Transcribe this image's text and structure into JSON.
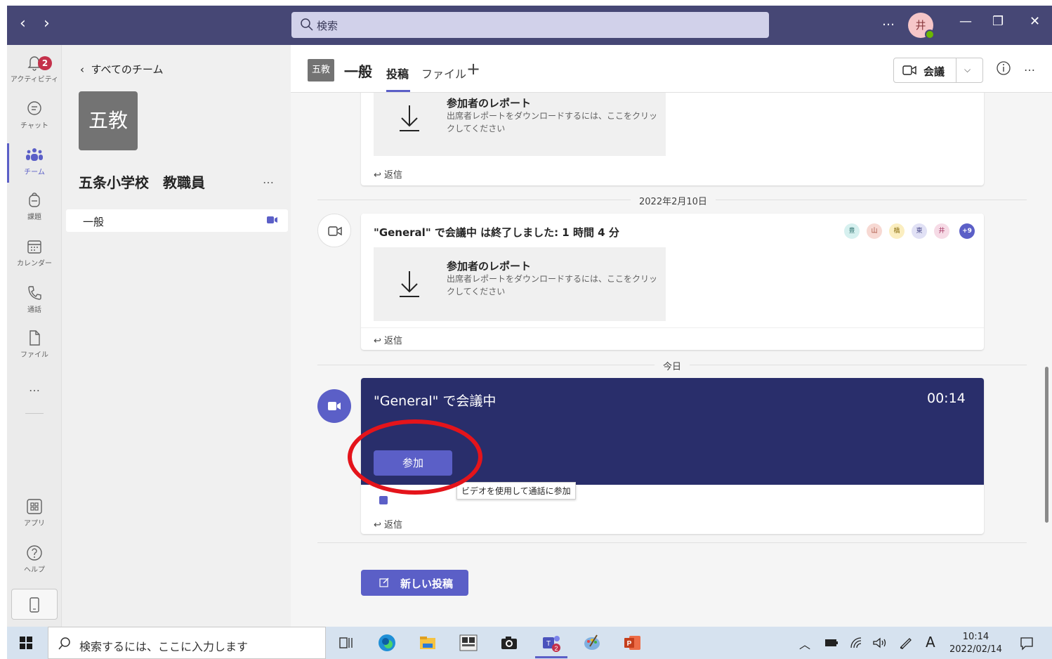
{
  "titlebar": {
    "back": "‹",
    "forward": "›",
    "search_placeholder": "検索",
    "more": "…",
    "avatar": "井",
    "minimize": "—",
    "restore": "❐",
    "close": "✕"
  },
  "rail": {
    "items": [
      {
        "label": "アクティビティ",
        "badge": "2"
      },
      {
        "label": "チャット"
      },
      {
        "label": "チーム"
      },
      {
        "label": "課題"
      },
      {
        "label": "カレンダー"
      },
      {
        "label": "通話"
      },
      {
        "label": "ファイル"
      },
      {
        "label": "アプリ"
      },
      {
        "label": "ヘルプ"
      }
    ],
    "more": "…"
  },
  "teampane": {
    "back_label": "すべてのチーム",
    "logo": "五教",
    "team_name": "五条小学校　教職員",
    "more": "…",
    "channel": "一般"
  },
  "header": {
    "tag": "五教",
    "title": "一般",
    "tab_posts": "投稿",
    "tab_files": "ファイル",
    "tab_add": "+",
    "meet_label": "会議",
    "more": "…"
  },
  "feed": {
    "report_title": "参加者のレポート",
    "report_desc": "出席者レポートをダウンロードするには、ここをクリックしてください",
    "reply": "返信",
    "date1": "2022年2月10日",
    "ended_text": "\"General\" で会議中 は終了しました: 1 時間 4 分",
    "participants": [
      "豊",
      "山",
      "橋",
      "東",
      "井",
      "+9"
    ],
    "date2": "今日",
    "live_title": "\"General\" で会議中",
    "live_time": "00:14",
    "join_label": "参加",
    "tooltip": "ビデオを使用して通話に参加",
    "new_post": "新しい投稿"
  },
  "taskbar": {
    "search_placeholder": "検索するには、ここに入力します",
    "time": "10:14",
    "date": "2022/02/14",
    "ime": "A"
  },
  "colors": {
    "titlebar": "#464775",
    "accent": "#5b5fc7",
    "live_card": "#292e6b",
    "highlight_ring": "#e4141b"
  }
}
